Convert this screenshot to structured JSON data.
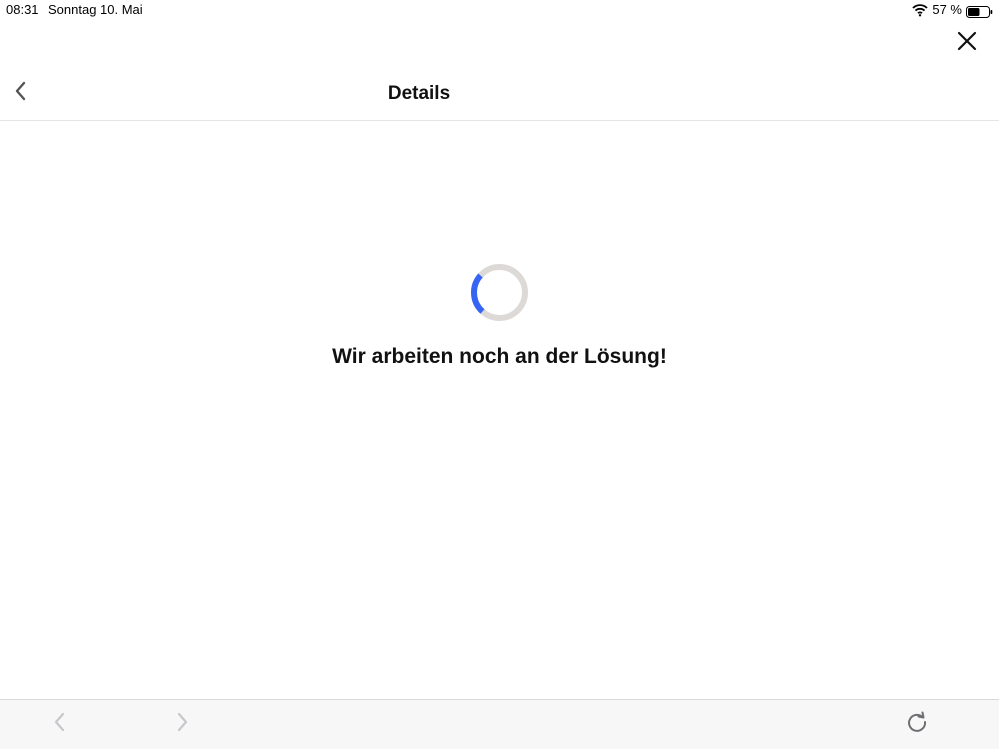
{
  "status_bar": {
    "time": "08:31",
    "date": "Sonntag 10. Mai",
    "battery": "57 %"
  },
  "header": {
    "title": "Details"
  },
  "content": {
    "message": "Wir arbeiten noch an der Lösung!"
  },
  "colors": {
    "accent": "#3665f3",
    "spinner_track": "#dcd9d6",
    "toolbar_bg": "#f7f7f7",
    "disabled_icon": "#c7c7cc",
    "active_icon": "#6e6e73"
  },
  "icons": {
    "close": "close-icon",
    "back": "chevron-left-icon",
    "browser_back": "chevron-left-icon",
    "browser_forward": "chevron-right-icon",
    "reload": "reload-icon"
  }
}
